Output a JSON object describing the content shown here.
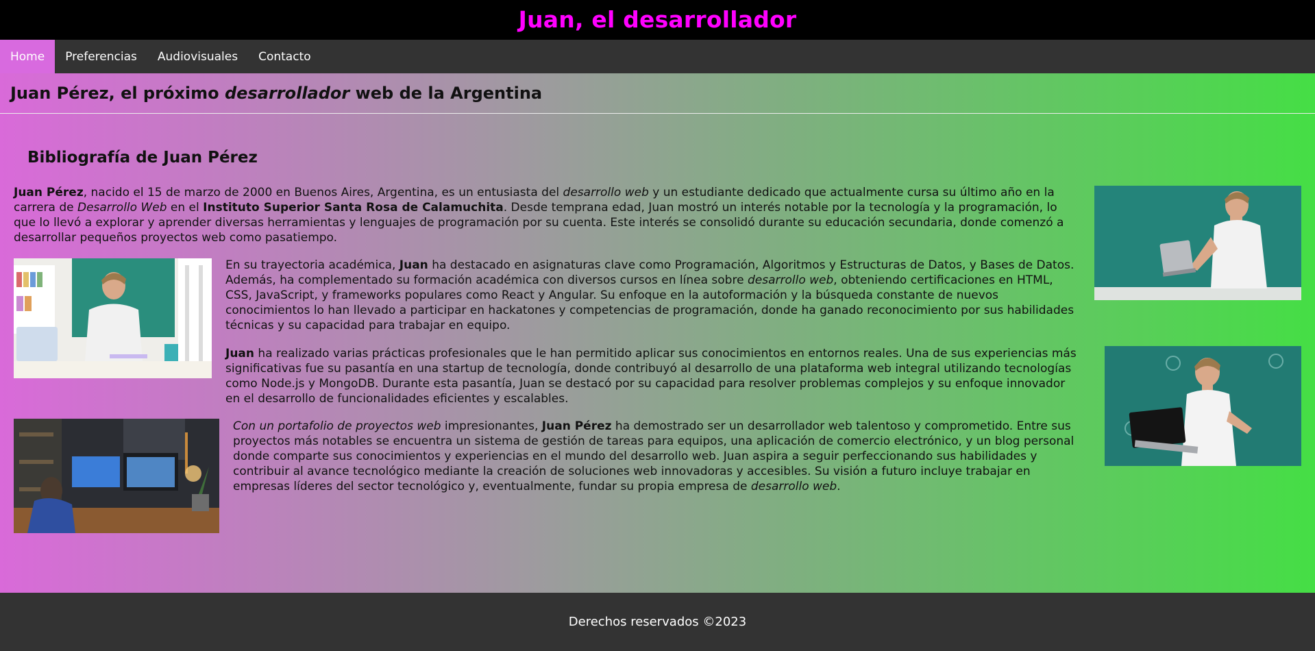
{
  "header": {
    "title": "Juan, el desarrollador"
  },
  "nav": {
    "items": [
      {
        "label": "Home",
        "active": true
      },
      {
        "label": "Preferencias"
      },
      {
        "label": "Audiovisuales"
      },
      {
        "label": "Contacto"
      }
    ]
  },
  "main": {
    "tagline": {
      "pre": "Juan Pérez, el próximo ",
      "em": "desarrollador",
      "post": " web de la Argentina"
    },
    "bio_heading": "Bibliografía de Juan Pérez",
    "p1": {
      "name": "Juan Pérez",
      "t1": ", nacido el 15 de marzo de 2000 en Buenos Aires, Argentina, es un entusiasta del ",
      "em1": "desarrollo web",
      "t2": " y un estudiante dedicado que actualmente cursa su último año en la carrera de ",
      "em2": "Desarrollo Web",
      "t3": " en el ",
      "institute": "Instituto Superior Santa Rosa de Calamuchita",
      "t4": ". Desde temprana edad, Juan mostró un interés notable por la tecnología y la programación, lo que lo llevó a explorar y aprender diversas herramientas y lenguajes de programación por su cuenta. Este interés se consolidó durante su educación secundaria, donde comenzó a desarrollar pequeños proyectos web como pasatiempo."
    },
    "p2": {
      "t1": "En su trayectoria académica, ",
      "name": "Juan",
      "t2": " ha destacado en asignaturas clave como Programación, Algoritmos y Estructuras de Datos, y Bases de Datos. Además, ha complementado su formación académica con diversos cursos en línea sobre ",
      "em": "desarrollo web",
      "t3": ", obteniendo certificaciones en HTML, CSS, JavaScript, y frameworks populares como React y Angular. Su enfoque en la autoformación y la búsqueda constante de nuevos conocimientos lo han llevado a participar en hackatones y competencias de programación, donde ha ganado reconocimiento por sus habilidades técnicas y su capacidad para trabajar en equipo."
    },
    "p3": {
      "name": "Juan",
      "t1": " ha realizado varias prácticas profesionales que le han permitido aplicar sus conocimientos en entornos reales. Una de sus experiencias más significativas fue su pasantía en una startup de tecnología, donde contribuyó al desarrollo de una plataforma web integral utilizando tecnologías como Node.js y MongoDB. Durante esta pasantía, Juan se destacó por su capacidad para resolver problemas complejos y su enfoque innovador en el desarrollo de funcionalidades eficientes y escalables."
    },
    "p4": {
      "em1": "Con un portafolio de proyectos web",
      "t1": " impresionantes, ",
      "name": "Juan Pérez",
      "t2": " ha demostrado ser un desarrollador web talentoso y comprometido. Entre sus proyectos más notables se encuentra un sistema de gestión de tareas para equipos, una aplicación de comercio electrónico, y un blog personal donde comparte sus conocimientos y experiencias en el mundo del desarrollo web. Juan aspira a seguir perfeccionando sus habilidades y contribuir al avance tecnológico mediante la creación de soluciones web innovadoras y accesibles. Su visión a futuro incluye trabajar en empresas líderes del sector tecnológico y, eventualmente, fundar su propia empresa de ",
      "em2": "desarrollo web",
      "t3": "."
    }
  },
  "footer": {
    "text": "Derechos reservados ©2023"
  }
}
